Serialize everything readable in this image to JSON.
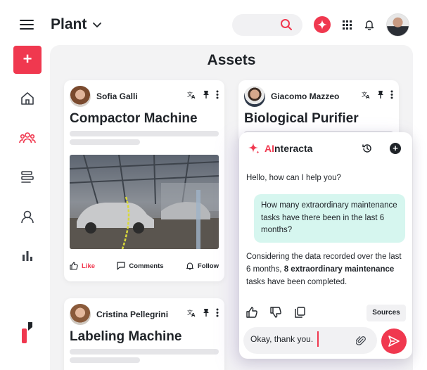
{
  "header": {
    "title": "Plant",
    "icons": [
      "menu-icon",
      "chevron-down-icon",
      "search-icon",
      "ai-sparkle-icon",
      "apps-grid-icon",
      "bell-icon"
    ]
  },
  "sidebar": {
    "add_label": "+",
    "items": [
      "home",
      "team",
      "assets",
      "people",
      "analytics"
    ],
    "active": "team"
  },
  "main": {
    "title": "Assets",
    "cards": [
      {
        "author": "Sofia Galli",
        "title": "Compactor Machine",
        "footer": {
          "like": "Like",
          "comments": "Comments",
          "follow": "Follow"
        }
      },
      {
        "author": "Giacomo Mazzeo",
        "title": "Biological Purifier"
      },
      {
        "author": "Cristina Pellegrini",
        "title": "Labeling Machine"
      }
    ]
  },
  "assistant": {
    "name_accent": "AI",
    "name_rest": "nteracta",
    "greeting": "Hello, how can I help you?",
    "user_message": "How many extraordinary maintenance tasks have there been in the last 6 months?",
    "reply_part1": "Considering the data recorded over the last 6 months, ",
    "reply_bold": "8 extraordinary maintenance",
    "reply_part2": " tasks have been completed.",
    "sources_label": "Sources",
    "input_value": "Okay, thank you."
  },
  "colors": {
    "accent": "#f0384f",
    "user_bubble": "#d6f6ef",
    "canvas_bg": "#f3f3f4"
  }
}
